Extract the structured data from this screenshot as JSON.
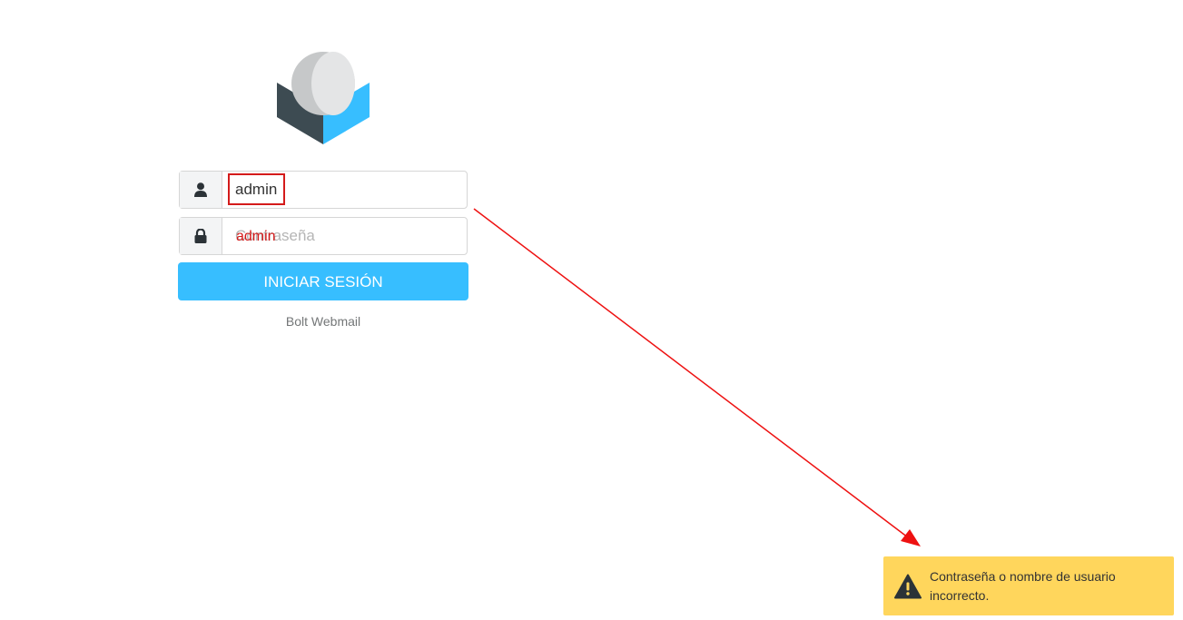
{
  "login": {
    "username_value": "admin",
    "password_placeholder": "Contraseña",
    "submit_label": "INICIAR SESIÓN",
    "footer_text": "Bolt Webmail"
  },
  "annotation": {
    "typed_text": "admin",
    "color": "#d41b1b"
  },
  "toast": {
    "message": "Contraseña o nombre de usuario incorrecto.",
    "background": "#ffd65c"
  },
  "icons": {
    "username": "user-icon",
    "password": "lock-icon",
    "toast": "warning-icon"
  },
  "colors": {
    "accent": "#37beff"
  }
}
